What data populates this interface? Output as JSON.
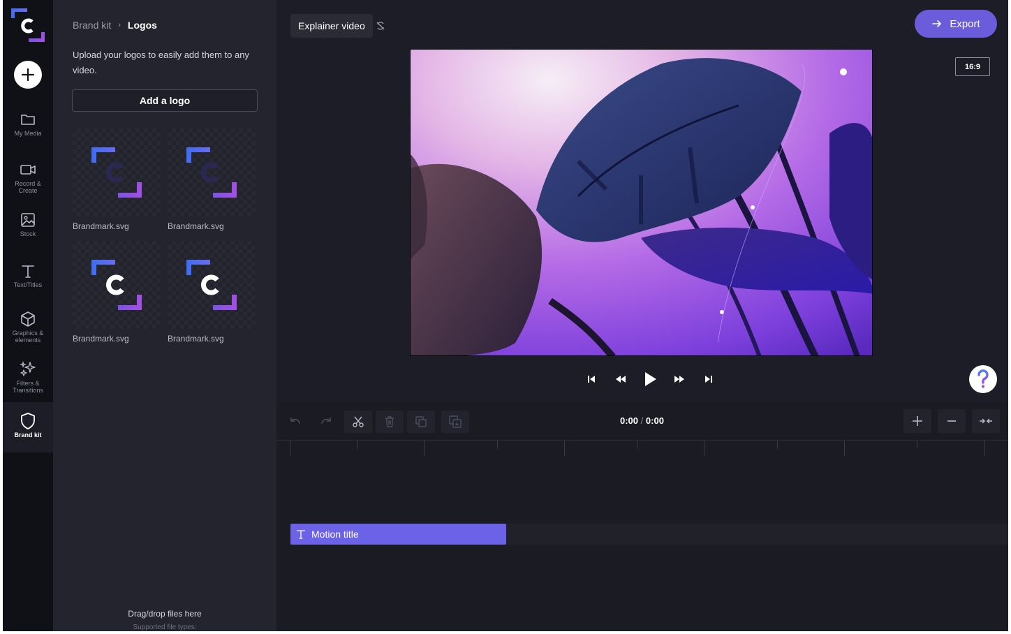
{
  "rail": {
    "items": [
      {
        "label": "My Media",
        "icon": "folder-icon"
      },
      {
        "label": "Record &\nCreate",
        "icon": "video-camera-icon"
      },
      {
        "label": "Stock",
        "icon": "image-icon"
      },
      {
        "label": "Text/Titles",
        "icon": "text-icon"
      },
      {
        "label": "Graphics &\nelements",
        "icon": "cube-icon"
      },
      {
        "label": "Filters &\nTransitions",
        "icon": "sparkles-icon"
      },
      {
        "label": "Brand kit",
        "icon": "shield-icon"
      }
    ]
  },
  "panel": {
    "breadcrumb_parent": "Brand kit",
    "breadcrumb_current": "Logos",
    "description": "Upload your logos to easily add them to any video.",
    "add_logo_label": "Add a logo",
    "logos": [
      {
        "name": "Brandmark.svg",
        "variant": "dark-c"
      },
      {
        "name": "Brandmark.svg",
        "variant": "dark-c"
      },
      {
        "name": "Brandmark.svg",
        "variant": "white-c"
      },
      {
        "name": "Brandmark.svg",
        "variant": "white-c"
      }
    ],
    "drop_hint": "Drag/drop files here",
    "drop_sub": "Supported file types:"
  },
  "stage": {
    "project_name": "Explainer video",
    "export_label": "Export",
    "aspect_ratio": "16:9",
    "help_label": "?"
  },
  "timeline": {
    "current_time": "0:00",
    "separator": "/",
    "total_time": "0:00",
    "clip_label": "Motion title"
  },
  "colors": {
    "accent": "#6a5cdb",
    "clip": "#6c62e8",
    "brand_blue": "#4f7cf0",
    "brand_purple": "#9b4fe0"
  }
}
